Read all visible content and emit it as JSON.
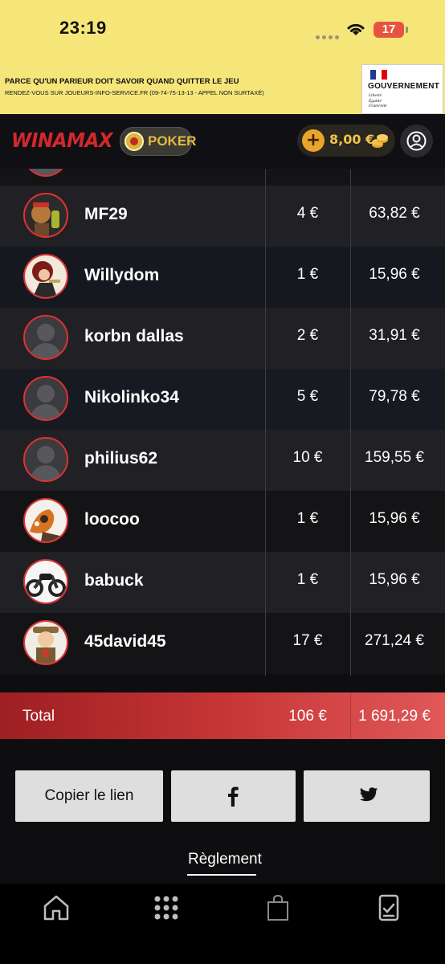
{
  "status_bar": {
    "time": "23:19",
    "battery": "17"
  },
  "banner": {
    "line1": "PARCE QU'UN PARIEUR DOIT SAVOIR QUAND QUITTER LE JEU",
    "line2": "RENDEZ-VOUS SUR JOUEURS-INFO-SERVICE.FR (09-74-75-13-13 - APPEL NON SURTAXÉ)",
    "gov_name": "GOUVERNEMENT",
    "gov_motto": [
      "Liberté",
      "Égalité",
      "Fraternité"
    ]
  },
  "header": {
    "logo": "WINAMAX",
    "poker_label": "POKER",
    "balance": "8,00 €",
    "colors": {
      "brand_red": "#d2282c",
      "gold": "#f0c34a"
    }
  },
  "players": [
    {
      "name": "MF29",
      "stake": "4 €",
      "prize": "63,82 €",
      "avatar": "custom-avatar-warrior"
    },
    {
      "name": "Willydom",
      "stake": "1 €",
      "prize": "15,96 €",
      "avatar": "custom-avatar-hero"
    },
    {
      "name": "korbn dallas",
      "stake": "2 €",
      "prize": "31,91 €",
      "avatar": "default-avatar"
    },
    {
      "name": "Nikolinko34",
      "stake": "5 €",
      "prize": "79,78 €",
      "avatar": "default-avatar"
    },
    {
      "name": "philius62",
      "stake": "10 €",
      "prize": "159,55 €",
      "avatar": "default-avatar"
    },
    {
      "name": "loocoo",
      "stake": "1 €",
      "prize": "15,96 €",
      "avatar": "custom-avatar-cartoon"
    },
    {
      "name": "babuck",
      "stake": "1 €",
      "prize": "15,96 €",
      "avatar": "custom-avatar-motorcycle"
    },
    {
      "name": "45david45",
      "stake": "17 €",
      "prize": "271,24 €",
      "avatar": "custom-avatar-explorer"
    }
  ],
  "total": {
    "label": "Total",
    "stake": "106 €",
    "prize": "1 691,29 €"
  },
  "share": {
    "copy_label": "Copier le lien",
    "facebook_icon": "facebook-icon",
    "twitter_icon": "twitter-icon"
  },
  "reglement": "Règlement",
  "tabbar": [
    "home-icon",
    "games-grid-icon",
    "shop-bag-icon",
    "bet-slip-icon"
  ]
}
